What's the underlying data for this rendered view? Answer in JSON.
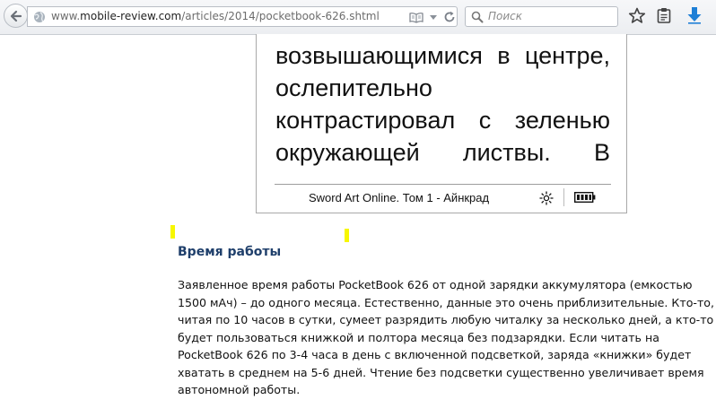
{
  "browser": {
    "url_prefix": "www.",
    "url_host": "mobile-review.com",
    "url_path": "/articles/2014/pocketbook-626.shtml",
    "search_placeholder": "Поиск"
  },
  "ereader": {
    "lines": [
      [
        "возвышающимися",
        "в",
        "центре,"
      ],
      [
        "ослепительно"
      ],
      [
        "контрастировал",
        "с",
        "зеленью"
      ],
      [
        "окружающей",
        "листвы.",
        "В"
      ]
    ],
    "status_title": "Sword Art Online. Том 1 - Айнкрад"
  },
  "article": {
    "heading": "Время работы",
    "lines": [
      "Заявленное время работы PocketBook 626 от одной зарядки аккумулятора (емкостью",
      "1500 мАч) – до одного месяца. Естественно, данные это очень приблизительные. Кто-то,",
      "читая по 10 часов в сутки, сумеет разрядить любую читалку за несколько дней, а кто-то",
      "будет пользоваться книжкой и полтора месяца без подзарядки. Если читать на",
      "PocketBook 626 по 3-4 часа в день с включенной подсветкой, заряда «книжки» будет",
      "хватать в среднем на 5-6 дней. Чтение без подсветки существенно увеличивает время",
      "автономной работы."
    ]
  },
  "colors": {
    "heading": "#1f3f6b",
    "marker": "#f7f700",
    "download_arrow": "#1e7fd6"
  }
}
